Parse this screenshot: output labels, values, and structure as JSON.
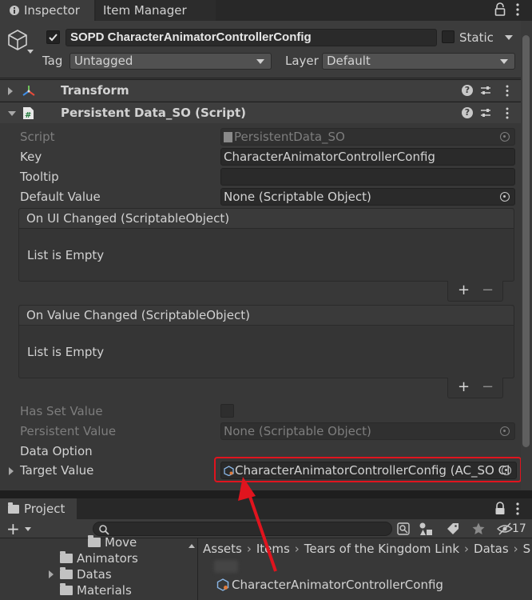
{
  "tabs": {
    "inspector": "Inspector",
    "item_manager": "Item Manager"
  },
  "header": {
    "object_name": "SOPD CharacterAnimatorControllerConfig",
    "active": true,
    "static_label": "Static",
    "tag_label": "Tag",
    "tag_value": "Untagged",
    "layer_label": "Layer",
    "layer_value": "Default"
  },
  "components": {
    "transform": "Transform",
    "script": "Persistent Data_SO (Script)"
  },
  "properties": {
    "script_label": "Script",
    "script_value": "PersistentData_SO",
    "key_label": "Key",
    "key_value": "CharacterAnimatorControllerConfig",
    "tooltip_label": "Tooltip",
    "tooltip_value": "",
    "default_value_label": "Default Value",
    "default_value": "None (Scriptable Object)",
    "on_ui_changed": "On UI Changed (ScriptableObject)",
    "on_value_changed": "On Value Changed (ScriptableObject)",
    "list_empty": "List is Empty",
    "has_set_value_label": "Has Set Value",
    "persistent_value_label": "Persistent Value",
    "persistent_value": "None (Scriptable Object)",
    "data_option_label": "Data Option",
    "target_value_label": "Target Value",
    "target_value": "CharacterAnimatorControllerConfig (AC_SO Cl"
  },
  "event_buttons": {
    "plus": "+",
    "minus": "−"
  },
  "project": {
    "tab": "Project",
    "plus": "+",
    "hidden_count": "17",
    "tree": [
      "Move",
      "Animators",
      "Datas",
      "Materials"
    ],
    "breadcrumbs": [
      "Assets",
      "Items",
      "Tears of the Kingdom Link",
      "Datas",
      "S"
    ],
    "asset": "CharacterAnimatorControllerConfig"
  },
  "colors": {
    "highlight": "#e0141e",
    "background": "#383838"
  }
}
